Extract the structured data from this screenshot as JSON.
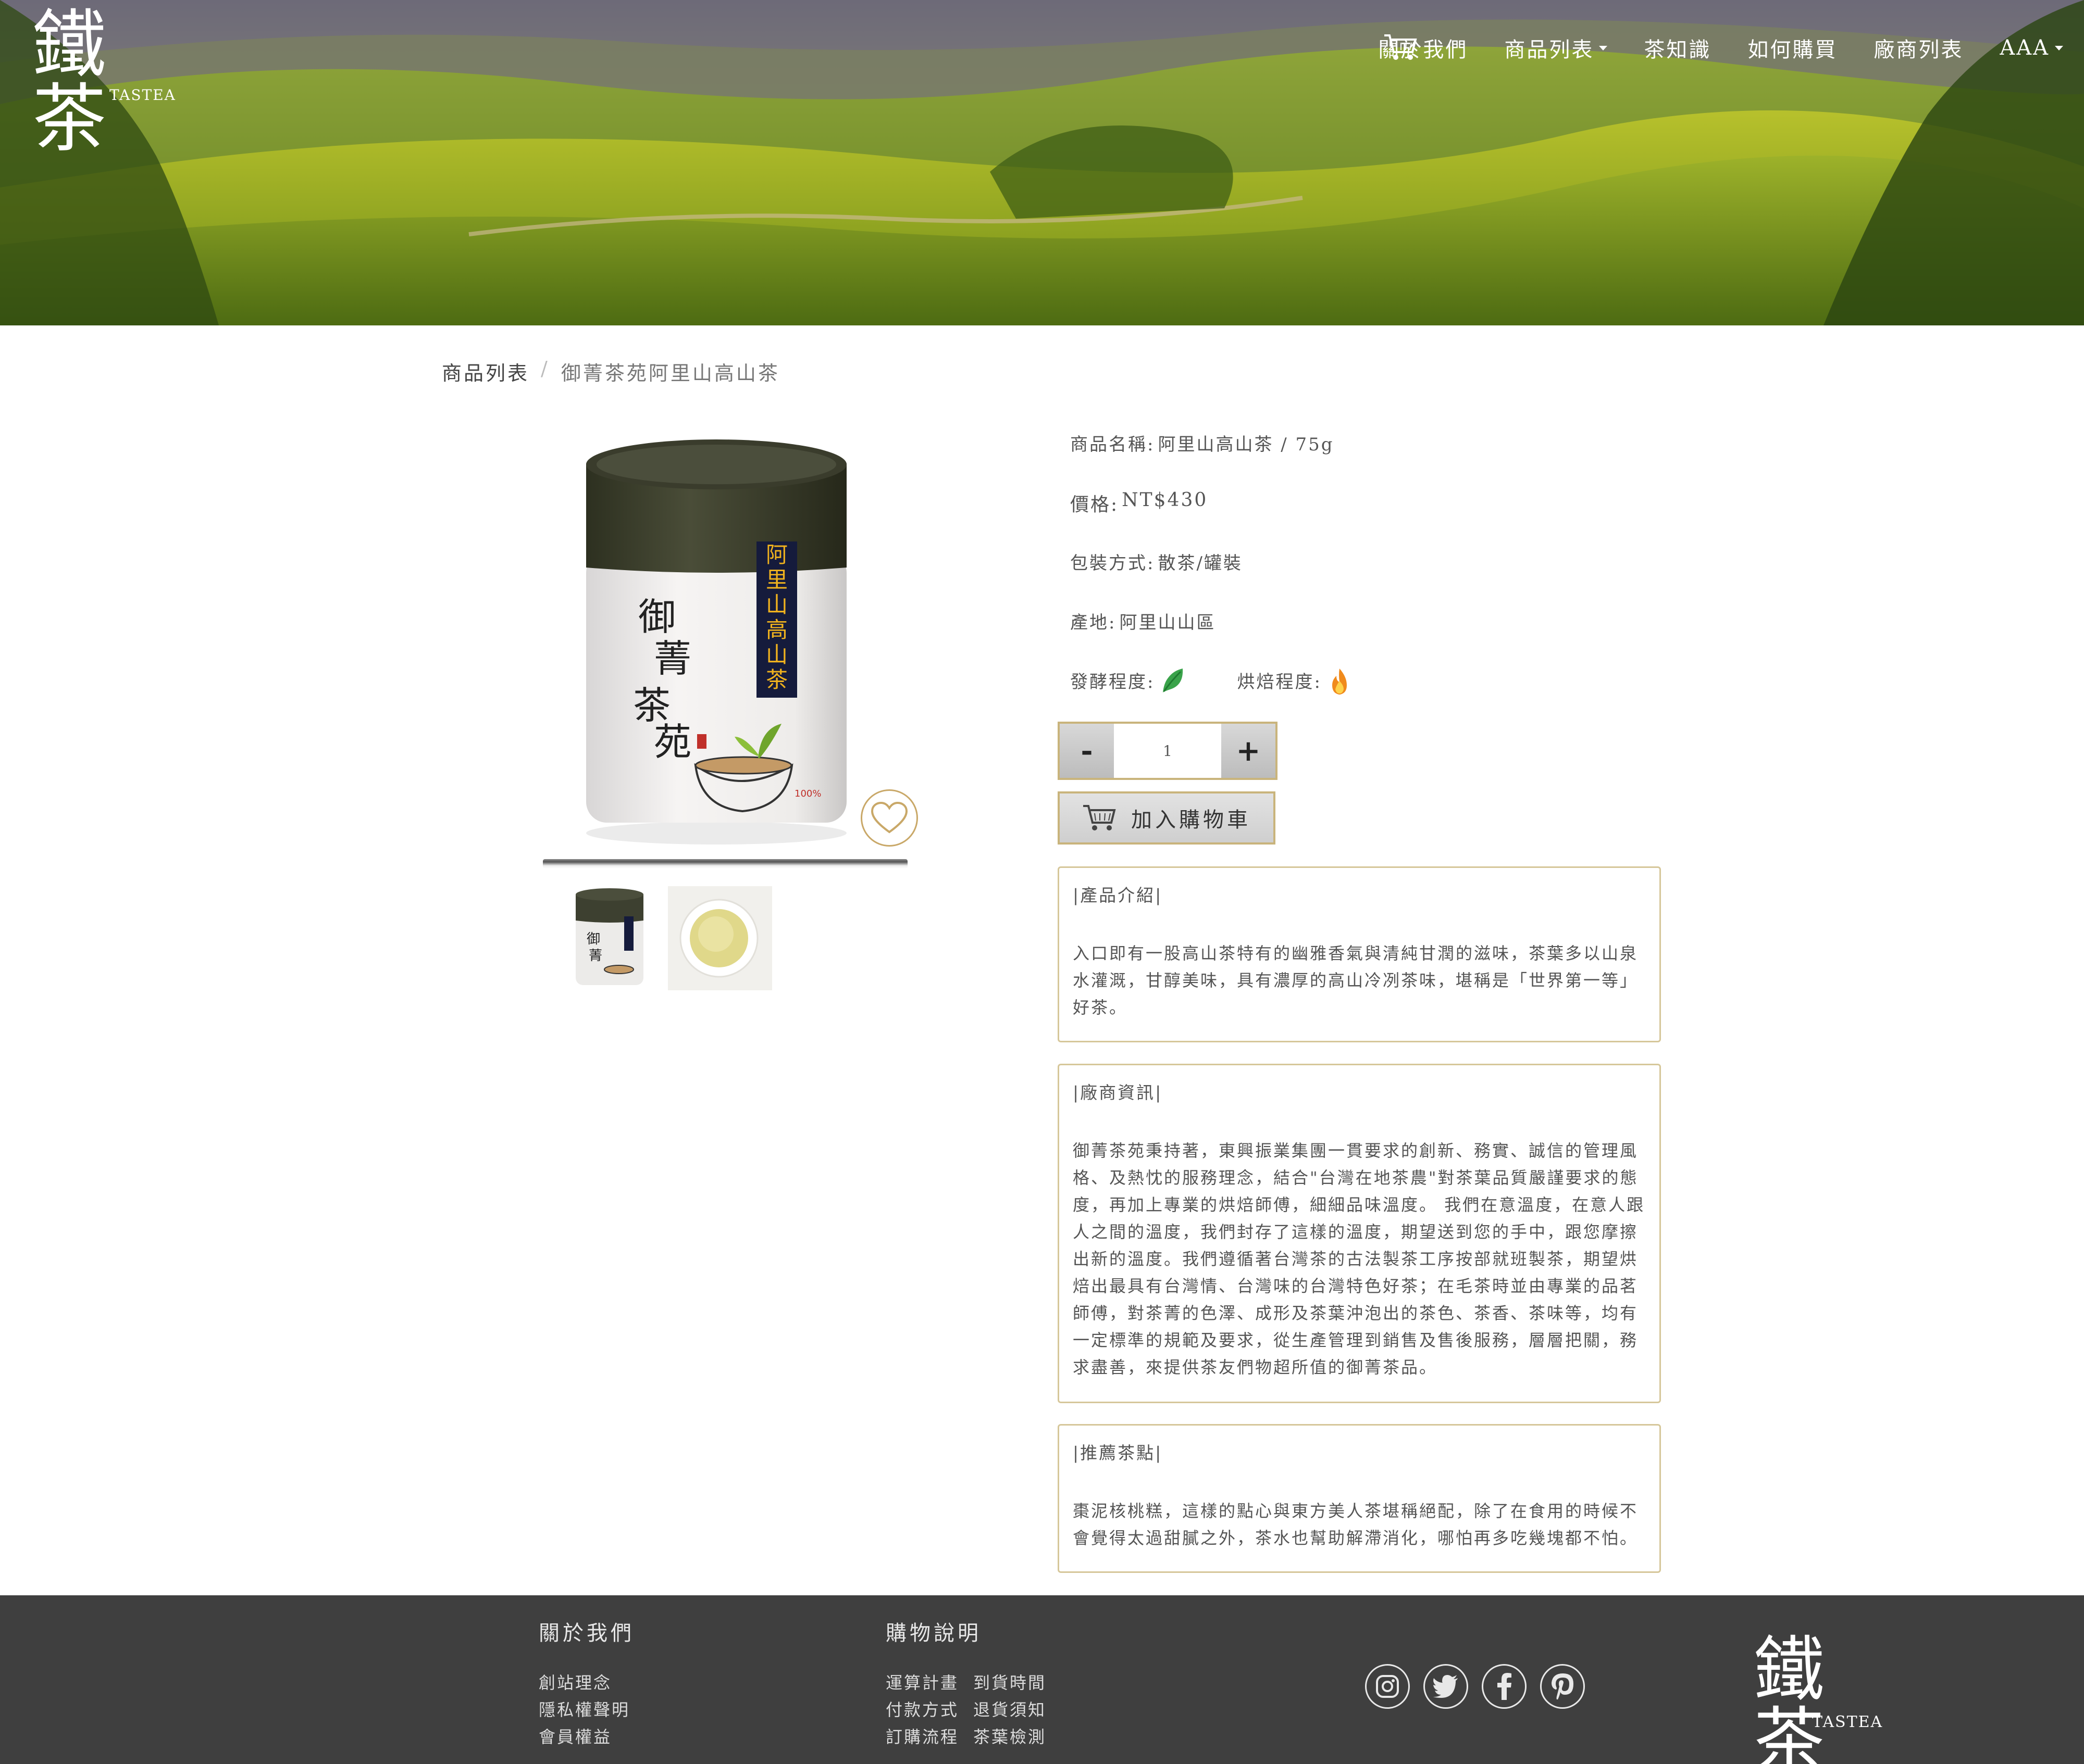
{
  "brand": {
    "logo_glyph": "鐵茶",
    "logo_sub": "TASTEA"
  },
  "nav": {
    "items": [
      {
        "label": "關於我們",
        "dropdown": false
      },
      {
        "label": "商品列表",
        "dropdown": true
      },
      {
        "label": "茶知識",
        "dropdown": false
      },
      {
        "label": "如何購買",
        "dropdown": false
      },
      {
        "label": "廠商列表",
        "dropdown": false
      },
      {
        "label": "AAA",
        "dropdown": true
      }
    ],
    "cart_icon": "cart-icon"
  },
  "breadcrumb": {
    "parent": "商品列表",
    "separator": "/",
    "current": "御菁茶苑阿里山高山茶"
  },
  "product": {
    "can_label": "阿里山高山茶",
    "can_brand": "御菁茶苑",
    "name_label": "商品名稱:",
    "name_value": "阿里山高山茶 / 75g",
    "price_label": "價格:",
    "price_value": "NT$430",
    "package_label": "包裝方式:",
    "package_value": "散茶/罐裝",
    "origin_label": "產地:",
    "origin_value": "阿里山山區",
    "ferment_label": "發酵程度:",
    "roast_label": "烘焙程度:",
    "quantity": "1",
    "minus": "-",
    "plus": "+",
    "add_to_cart": "加入購物車"
  },
  "sections": {
    "intro": {
      "heading": "|產品介紹|",
      "text": "入口即有一股高山茶特有的幽雅香氣與清純甘潤的滋味，茶葉多以山泉水灌溉，甘醇美味，具有濃厚的高山冷冽茶味，堪稱是「世界第一等」好茶。"
    },
    "vendor": {
      "heading": "|廠商資訊|",
      "text": "御菁茶苑秉持著，東興振業集團一貫要求的創新、務實、誠信的管理風格、及熱忱的服務理念，結合\"台灣在地茶農\"對茶葉品質嚴謹要求的態度，再加上專業的烘焙師傅，細細品味溫度。 我們在意溫度，在意人跟人之間的溫度，我們封存了這樣的溫度，期望送到您的手中，跟您摩擦出新的溫度。我們遵循著台灣茶的古法製茶工序按部就班製茶，期望烘焙出最具有台灣情、台灣味的台灣特色好茶；在毛茶時並由專業的品茗師傅，對茶菁的色澤、成形及茶葉沖泡出的茶色、茶香、茶味等，均有一定標準的規範及要求，從生產管理到銷售及售後服務，層層把關，務求盡善，來提供茶友們物超所值的御菁茶品。"
    },
    "snack": {
      "heading": "|推薦茶點|",
      "text": "棗泥核桃糕，這樣的點心與東方美人茶堪稱絕配，除了在食用的時候不會覺得太過甜膩之外，茶水也幫助解滯消化，哪怕再多吃幾塊都不怕。"
    }
  },
  "footer": {
    "about_title": "關於我們",
    "about_links": [
      "創站理念",
      "隱私權聲明",
      "會員權益"
    ],
    "shop_title": "購物說明",
    "shop_links": [
      "運算計畫",
      "到貨時間",
      "付款方式",
      "退貨須知",
      "訂購流程",
      "茶葉檢測"
    ],
    "social": [
      "instagram-icon",
      "twitter-icon",
      "facebook-icon",
      "pinterest-icon"
    ],
    "logo_glyph": "鐵茶",
    "logo_sub": "TASTEA"
  },
  "colors": {
    "gold_border": "#c9b47c",
    "footer_bg": "#3f3f3f",
    "leaf_green": "#3aa34a",
    "flame_orange": "#f08a1c"
  }
}
